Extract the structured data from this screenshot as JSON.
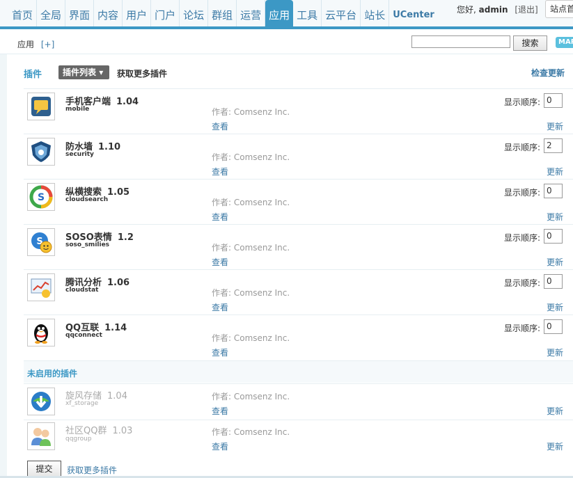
{
  "nav": {
    "items": [
      "首页",
      "全局",
      "界面",
      "内容",
      "用户",
      "门户",
      "论坛",
      "群组",
      "运营",
      "应用",
      "工具",
      "云平台",
      "站长",
      "UCenter"
    ],
    "active_index": 9
  },
  "user": {
    "greeting": "您好,",
    "name": "admin",
    "logout": "[退出]",
    "site_button": "站点首页"
  },
  "subbar": {
    "crumb": "应用",
    "crumb_add": "[+]",
    "search_placeholder": "",
    "search_button": "搜索",
    "map_button": "MAP"
  },
  "header": {
    "title": "插件",
    "list_button": "插件列表",
    "more_plugins": "获取更多插件",
    "check_updates": "检查更新"
  },
  "labels": {
    "author_prefix": "作者: ",
    "view": "查看",
    "update": "更新",
    "order": "显示顺序:"
  },
  "plugins": [
    {
      "name": "手机客户端",
      "version": "1.04",
      "id": "mobile",
      "author": "作者: Comsenz Inc.",
      "order": "0",
      "icon": "mobile-client-icon"
    },
    {
      "name": "防水墙",
      "version": "1.10",
      "id": "security",
      "author": "作者: Comsenz Inc.",
      "order": "2",
      "icon": "security-shield-icon"
    },
    {
      "name": "纵横搜索",
      "version": "1.05",
      "id": "cloudsearch",
      "author": "作者: Comsenz Inc.",
      "order": "0",
      "icon": "cloudsearch-icon"
    },
    {
      "name": "SOSO表情",
      "version": "1.2",
      "id": "soso_smilies",
      "author": "作者: Comsenz Inc.",
      "order": "0",
      "icon": "soso-smilies-icon"
    },
    {
      "name": "腾讯分析",
      "version": "1.06",
      "id": "cloudstat",
      "author": "作者: Comsenz Inc.",
      "order": "0",
      "icon": "cloudstat-icon"
    },
    {
      "name": "QQ互联",
      "version": "1.14",
      "id": "qqconnect",
      "author": "作者: Comsenz Inc.",
      "order": "0",
      "icon": "qq-penguin-icon"
    }
  ],
  "unused": {
    "title": "未启用的插件",
    "plugins": [
      {
        "name": "旋风存储",
        "version": "1.04",
        "id": "xf_storage",
        "author": "作者: Comsenz Inc.",
        "icon": "xf-storage-icon"
      },
      {
        "name": "社区QQ群",
        "version": "1.03",
        "id": "qqgroup",
        "author": "作者: Comsenz Inc.",
        "icon": "qqgroup-icon"
      }
    ]
  },
  "footer": {
    "submit": "提交",
    "more_plugins": "获取更多插件"
  }
}
